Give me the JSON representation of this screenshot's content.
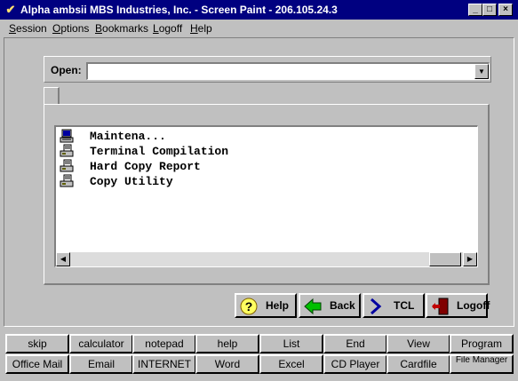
{
  "window": {
    "title": "Alpha ambsii MBS Industries, Inc. - Screen Paint - 206.105.24.3",
    "icon": "checkmark-logo-icon",
    "controls": [
      "minimize",
      "maximize",
      "close"
    ]
  },
  "menu": [
    "Session",
    "Options",
    "Bookmarks",
    "Logoff",
    "Help"
  ],
  "open": {
    "label": "Open:",
    "value": ""
  },
  "list": {
    "items": [
      {
        "label": "Maintena...",
        "icon": "terminal-icon"
      },
      {
        "label": "Terminal Compilation",
        "icon": "printer-icon"
      },
      {
        "label": "Hard Copy Report",
        "icon": "printer-icon"
      },
      {
        "label": "Copy Utility",
        "icon": "printer-icon"
      }
    ]
  },
  "actions": [
    {
      "label": "Help",
      "icon": "question-icon"
    },
    {
      "label": "Back",
      "icon": "back-arrow-icon"
    },
    {
      "label": "TCL",
      "icon": "chevron-right-icon"
    },
    {
      "label": "Logoff",
      "icon": "exit-door-icon"
    }
  ],
  "toolbar": {
    "row1": [
      "skip",
      "calculator",
      "notepad",
      "help",
      "List",
      "End",
      "View",
      "Program"
    ],
    "row2": [
      "Office Mail",
      "Email",
      "INTERNET",
      "Word",
      "Excel",
      "CD Player",
      "Cardfile",
      "File Manager"
    ]
  },
  "colors": {
    "titlebar": "#000080",
    "face": "#c0c0c0"
  }
}
